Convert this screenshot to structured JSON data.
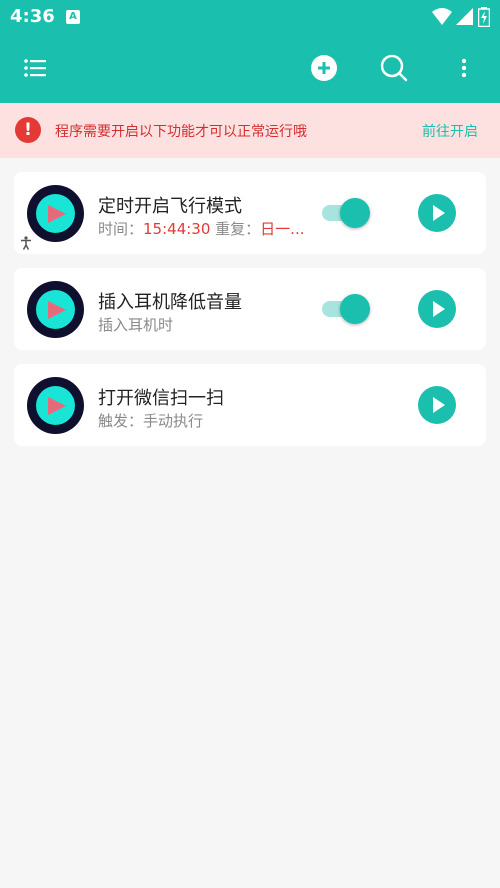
{
  "status_bar": {
    "time": "4:36",
    "notification_letter": "A"
  },
  "toolbar": {
    "menu_icon": "list-menu-icon",
    "add_icon": "add-circle-icon",
    "search_icon": "search-icon",
    "more_icon": "more-vert-icon"
  },
  "banner": {
    "icon": "!",
    "text": "程序需要开启以下功能才可以正常运行哦",
    "link": "前往开启"
  },
  "tasks": [
    {
      "title": "定时开启飞行模式",
      "sub_prefix": "时间：",
      "sub_time": "15:44:30",
      "sub_middle": " 重复：",
      "sub_repeat": "日一...",
      "toggle_on": true
    },
    {
      "title": "插入耳机降低音量",
      "sub": "插入耳机时",
      "toggle_on": true
    },
    {
      "title": "打开微信扫一扫",
      "sub": "触发：手动执行"
    }
  ],
  "colors": {
    "primary": "#1abfae",
    "banner_bg": "#fde0e0",
    "error_red": "#e53935"
  }
}
